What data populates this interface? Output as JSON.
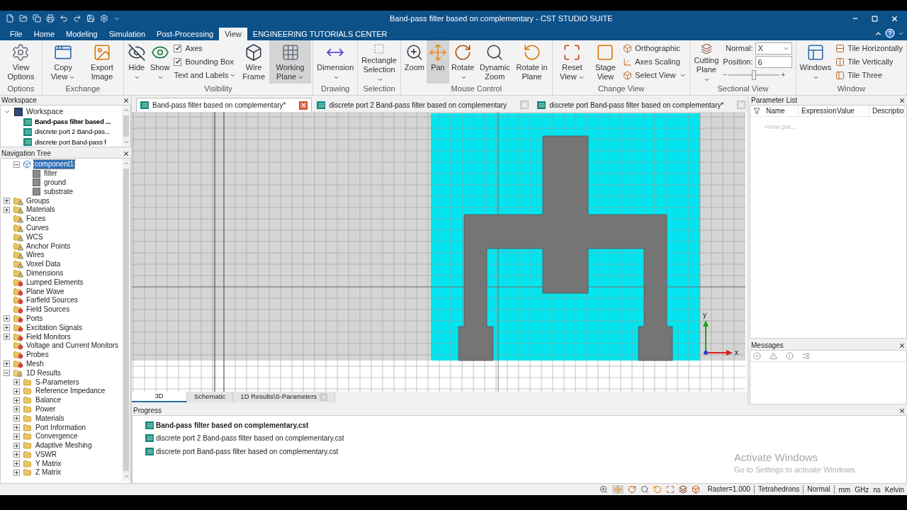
{
  "window": {
    "title": "Band-pass filter based on complementary - CST STUDIO SUITE"
  },
  "menu_tabs": [
    {
      "label": "File",
      "selected": false
    },
    {
      "label": "Home",
      "selected": false
    },
    {
      "label": "Modeling",
      "selected": false
    },
    {
      "label": "Simulation",
      "selected": false
    },
    {
      "label": "Post-Processing",
      "selected": false
    },
    {
      "label": "View",
      "selected": true
    },
    {
      "label": "ENGINEERING TUTORIALS CENTER",
      "selected": false
    }
  ],
  "ribbon": [
    {
      "label": "Options",
      "items": [
        {
          "kind": "large",
          "label": "View Options",
          "dropdown": false,
          "selected": false
        }
      ]
    },
    {
      "label": "Exchange",
      "items": [
        {
          "kind": "large",
          "label": "Copy View",
          "dropdown": true,
          "selected": false
        },
        {
          "kind": "large",
          "label": "Export Image",
          "dropdown": false,
          "selected": false
        }
      ]
    },
    {
      "label": "Visibility",
      "items": [
        {
          "kind": "large",
          "label": "Hide",
          "dropdown": true,
          "selected": false
        },
        {
          "kind": "large",
          "label": "Show",
          "dropdown": true,
          "selected": false
        },
        {
          "kind": "column",
          "items": [
            {
              "kind": "check",
              "label": "Axes",
              "checked": true
            },
            {
              "kind": "check",
              "label": "Bounding Box",
              "checked": true
            },
            {
              "kind": "menu",
              "label": "Text and Labels",
              "dropdown": true
            }
          ]
        },
        {
          "kind": "large",
          "label": "Wire Frame",
          "dropdown": false,
          "selected": false
        },
        {
          "kind": "large",
          "label": "Working Plane",
          "dropdown": true,
          "selected": true
        }
      ]
    },
    {
      "label": "Drawing",
      "items": [
        {
          "kind": "large",
          "label": "Dimension",
          "dropdown": true,
          "selected": false
        }
      ]
    },
    {
      "label": "Selection",
      "items": [
        {
          "kind": "large",
          "label": "Rectangle Selection",
          "dropdown": true,
          "selected": false
        }
      ]
    },
    {
      "label": "Mouse Control",
      "items": [
        {
          "kind": "large",
          "label": "Zoom",
          "dropdown": false,
          "selected": false
        },
        {
          "kind": "large",
          "label": "Pan",
          "dropdown": false,
          "selected": true
        },
        {
          "kind": "large",
          "label": "Rotate",
          "dropdown": true,
          "selected": false
        },
        {
          "kind": "large",
          "label": "Dynamic Zoom",
          "dropdown": false,
          "selected": false
        },
        {
          "kind": "large",
          "label": "Rotate in Plane",
          "dropdown": false,
          "selected": false
        }
      ]
    },
    {
      "label": "Change View",
      "items": [
        {
          "kind": "large",
          "label": "Reset View",
          "dropdown": true,
          "selected": false
        },
        {
          "kind": "large",
          "label": "Stage View",
          "dropdown": false,
          "selected": false
        },
        {
          "kind": "column",
          "items": [
            {
              "kind": "small",
              "label": "Orthographic",
              "dropdown": false
            },
            {
              "kind": "small",
              "label": "Axes Scaling",
              "dropdown": false
            },
            {
              "kind": "small",
              "label": "Select View",
              "dropdown": true
            }
          ]
        }
      ]
    },
    {
      "label": "Sectional View",
      "items": [
        {
          "kind": "large",
          "label": "Cutting Plane",
          "dropdown": true,
          "selected": false
        },
        {
          "kind": "form",
          "fields": [
            {
              "kind": "select",
              "label": "Normal:",
              "value": "X"
            },
            {
              "kind": "input",
              "label": "Position:",
              "value": "6"
            }
          ],
          "slider": {
            "minus": "−",
            "plus": "+",
            "level": 0.5
          }
        }
      ]
    },
    {
      "label": "Window",
      "items": [
        {
          "kind": "large",
          "label": "Windows",
          "dropdown": true,
          "selected": false
        },
        {
          "kind": "column",
          "items": [
            {
              "kind": "small",
              "label": "Tile Horizontally",
              "dropdown": false
            },
            {
              "kind": "small",
              "label": "Tile Vertically",
              "dropdown": false
            },
            {
              "kind": "small",
              "label": "Tile Three",
              "dropdown": false
            }
          ]
        }
      ]
    }
  ],
  "workspace": {
    "title": "Workspace",
    "root": "Workspace",
    "expanded": true,
    "files": [
      {
        "label": "Band-pass filter based ...",
        "active": true
      },
      {
        "label": "discrete port 2 Band-pas...",
        "active": false
      },
      {
        "label": "discrete port Band-pass f",
        "active": false
      }
    ]
  },
  "navigation_tree": {
    "title": "Navigation Tree",
    "partial_items": [
      {
        "label": "component1",
        "kind": "component",
        "selected": true,
        "expanded": true,
        "children": [
          {
            "label": "filter",
            "kind": "solid",
            "selected": false
          },
          {
            "label": "ground",
            "kind": "solid",
            "selected": false
          },
          {
            "label": "substrate",
            "kind": "solid",
            "selected": false
          }
        ]
      }
    ],
    "items": [
      {
        "label": "Groups",
        "kind": "warning-folder",
        "selected": false,
        "expanded": false
      },
      {
        "label": "Materials",
        "kind": "warning-folder",
        "selected": false,
        "expanded": false
      },
      {
        "label": "Faces",
        "kind": "warning-folder",
        "selected": false
      },
      {
        "label": "Curves",
        "kind": "warning-folder",
        "selected": false
      },
      {
        "label": "WCS",
        "kind": "warning-folder",
        "selected": false
      },
      {
        "label": "Anchor Points",
        "kind": "warning-folder",
        "selected": false
      },
      {
        "label": "Wires",
        "kind": "warning-folder",
        "selected": false
      },
      {
        "label": "Voxel Data",
        "kind": "warning-folder",
        "selected": false
      },
      {
        "label": "Dimensions",
        "kind": "warning-folder",
        "selected": false
      },
      {
        "label": "Lumped Elements",
        "kind": "source-folder",
        "selected": false
      },
      {
        "label": "Plane Wave",
        "kind": "source-folder",
        "selected": false
      },
      {
        "label": "Farfield Sources",
        "kind": "source-folder",
        "selected": false
      },
      {
        "label": "Field Sources",
        "kind": "source-folder",
        "selected": false
      },
      {
        "label": "Ports",
        "kind": "source-folder",
        "selected": false,
        "expanded": false
      },
      {
        "label": "Excitation Signals",
        "kind": "source-folder",
        "selected": false,
        "expanded": false
      },
      {
        "label": "Field Monitors",
        "kind": "source-folder",
        "selected": false,
        "expanded": false
      },
      {
        "label": "Voltage and Current Monitors",
        "kind": "source-folder",
        "selected": false
      },
      {
        "label": "Probes",
        "kind": "source-folder",
        "selected": false
      },
      {
        "label": "Mesh",
        "kind": "source-folder",
        "selected": false,
        "expanded": false
      },
      {
        "label": "1D Results",
        "kind": "results-folder",
        "selected": false,
        "expanded": true,
        "children": [
          {
            "label": "S-Parameters",
            "kind": "folder",
            "selected": false,
            "expanded": false
          },
          {
            "label": "Reference Impedance",
            "kind": "folder",
            "selected": false,
            "expanded": false
          },
          {
            "label": "Balance",
            "kind": "folder",
            "selected": false,
            "expanded": false
          },
          {
            "label": "Power",
            "kind": "folder",
            "selected": false,
            "expanded": false
          },
          {
            "label": "Materials",
            "kind": "folder",
            "selected": false,
            "expanded": false
          },
          {
            "label": "Port Information",
            "kind": "folder",
            "selected": false,
            "expanded": false
          },
          {
            "label": "Convergence",
            "kind": "folder",
            "selected": false,
            "expanded": false
          },
          {
            "label": "Adaptive Meshing",
            "kind": "folder",
            "selected": false,
            "expanded": false
          },
          {
            "label": "VSWR",
            "kind": "folder",
            "selected": false,
            "expanded": false
          },
          {
            "label": "Y Matrix",
            "kind": "folder",
            "selected": false,
            "expanded": false
          },
          {
            "label": "Z Matrix",
            "kind": "folder",
            "selected": false,
            "expanded": false
          }
        ]
      }
    ]
  },
  "document_tabs": [
    {
      "label": "Band-pass filter based on complementary*",
      "selected": true
    },
    {
      "label": "discrete port 2 Band-pass filter based on complementary",
      "selected": false
    },
    {
      "label": "discrete port Band-pass filter based on complementary*",
      "selected": false
    }
  ],
  "viewport": {
    "axis_y": "y",
    "axis_x": "x"
  },
  "view_tabs": [
    {
      "label": "3D",
      "selected": true,
      "closable": false
    },
    {
      "label": "Schematic",
      "selected": false,
      "closable": false
    },
    {
      "label": "1D Results\\S-Parameters",
      "selected": false,
      "closable": true
    }
  ],
  "parameter_list": {
    "title": "Parameter List",
    "columns": [
      "Name",
      "Expression",
      "Value",
      "Descriptio"
    ],
    "placeholder": "<new par..."
  },
  "messages": {
    "title": "Messages"
  },
  "progress": {
    "title": "Progress",
    "items": [
      {
        "label": "Band-pass filter based on complementary.cst",
        "active": true
      },
      {
        "label": "discrete port 2 Band-pass filter based on complementary.cst",
        "active": false
      },
      {
        "label": "discrete port Band-pass filter based on complementary.cst",
        "active": false
      }
    ]
  },
  "os_notice": {
    "title": "Activate Windows",
    "subtitle": "Go to Settings to activate Windows."
  },
  "status_bar": {
    "fields": [
      "Raster=1.000",
      "Tetrahedrons",
      "Normal"
    ],
    "units": [
      "mm",
      "GHz",
      "ns",
      "Kelvin"
    ]
  }
}
